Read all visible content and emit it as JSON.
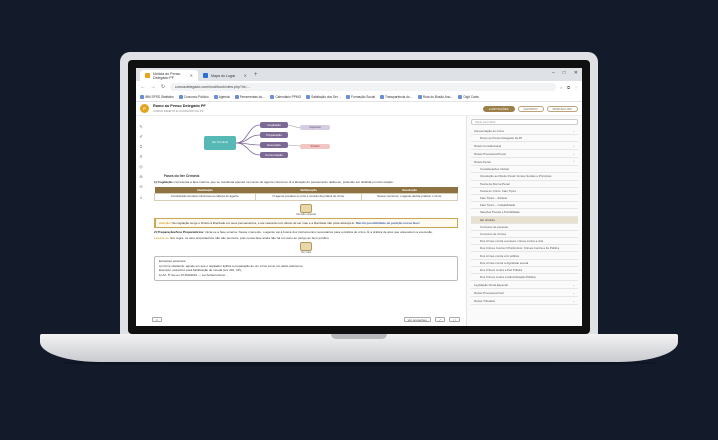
{
  "browser": {
    "tabs": [
      {
        "label": "Notícia ao Penso Delegado PF"
      },
      {
        "label": "Mapa do Lugar"
      }
    ],
    "newtab": "+",
    "window_controls": [
      "–",
      "□",
      "✕"
    ],
    "url": "cursosdelegado.com/mod/book/view.php?id=...",
    "bookmarks": [
      "IBM SPSS Statistics",
      "Concurso Público",
      "Agenda",
      "Ferramentas do…",
      "Calendário PPMG",
      "Satisfação dos Ser…",
      "Formação Social",
      "Transparência do…",
      "Rota do Busão Ano…",
      "Digit Carta"
    ]
  },
  "app": {
    "title": "Rumo ao Penso Delegado PF",
    "subtitle": "CURSO DIREITO E CONTEÚDO DA PF",
    "logo_letter": "P",
    "actions": [
      {
        "label": "● ANOTAÇÕES"
      },
      {
        "label": "FAVORITO"
      },
      {
        "label": "MARCAR LIDO"
      }
    ]
  },
  "mindmap": {
    "center": "Iter Criminis",
    "nodes": [
      "Cogitação",
      "Preparação",
      "Execução",
      "Consumação"
    ],
    "leaves": [
      {
        "label": "Impunível",
        "color": "#d6cde3"
      },
      {
        "label": "Punível",
        "color": "#f3c6c6"
      }
    ]
  },
  "doc": {
    "section_title": "Fases do Iter Criminis",
    "p1_lead": "1) Cogitação:",
    "p1_text": " representa a fase interna, que se manifesta apenas na mente do agente criminoso. É a ideação do pensamento delituoso, podendo ser dividida em três etapas:",
    "table": {
      "headers": [
        "Idealização",
        "Deliberação",
        "Resolução"
      ],
      "row": [
        "Constituição da ideia criminosa na cabeça do agente.",
        "O agente pondera os prós e contras da prática do crime.",
        "Nesse momento, o agente decide praticar o crime."
      ]
    },
    "figure_caption": "Atenção especial",
    "callout_hl": "Atenção!",
    "callout_text": " Na cogitação surge o Direito à liberdade em seus pensamentos, e ele nasceria num direito de ser mau e a liberdade não pode alcançá-lo.",
    "callout_link": "Não há possibilidade de punição nessa fase!",
    "p2_lead": "2) Preparação/Atos Preparatórios:",
    "p2_text": " inicia-se a fase externa. Nesse momento, o agente vai à busca dos instrumentos necessários para a prática do crime. É a prática de atos que antecedem a execução.",
    "p3_hl": "Lembre-se:",
    "p3_text": " Em regra, os atos preparatórios não são puníveis, pois nessa fase ainda não há um risco ao perigo ao bem jurídico.",
    "figure2_caption": "Ver mais",
    "note_lines": [
      "Exceções possíveis:",
      "a) Crime obstáculo: aquele em que o legislador tipifica a preparação de um crime como um delito autônomo;",
      "Exemplo: petrechos para falsificação de moeda (art. 291, CP);",
      "b) Art. 5º da Lei 13.260/2016 — Lei Antiterrorismo..."
    ]
  },
  "bottom": {
    "left": "1",
    "audio": "Ver anotações",
    "right": [
      "⤢",
      "▢"
    ]
  },
  "sidebar": {
    "search_placeholder": "Digite para filtrar",
    "items": [
      {
        "label": "Apresentação do Curso",
        "level": 0,
        "chev": "⌄"
      },
      {
        "label": "Rumo ao Penso Delegado da PF",
        "level": 1,
        "chev": ""
      },
      {
        "label": "Direito Constitucional",
        "level": 0,
        "chev": "⌄"
      },
      {
        "label": "Direito Processual Penal",
        "level": 0,
        "chev": "⌄"
      },
      {
        "label": "Direito Penal",
        "level": 0,
        "chev": "⌃"
      },
      {
        "label": "Considerações Iniciais",
        "level": 1,
        "chev": ""
      },
      {
        "label": "Introdução ao Direito Penal: Fontes Sociais e Princípios",
        "level": 1,
        "chev": ""
      },
      {
        "label": "Teoria da Norma Penal",
        "level": 1,
        "chev": ""
      },
      {
        "label": "Teoria do Crime: Fato Típico",
        "level": 1,
        "chev": ""
      },
      {
        "label": "Fato Típico – Ilicitude",
        "level": 1,
        "chev": ""
      },
      {
        "label": "Fato Típico – Culpabilidade",
        "level": 1,
        "chev": ""
      },
      {
        "label": "Sanções Penais e Punibilidade",
        "level": 1,
        "chev": ""
      },
      {
        "label": "Iter criminis",
        "level": 1,
        "chev": "",
        "active": true
      },
      {
        "label": "Concurso de pessoas",
        "level": 1,
        "chev": ""
      },
      {
        "label": "Concurso de Crimes",
        "level": 1,
        "chev": ""
      },
      {
        "label": "Dos crimes contra a pessoa: crimes contra a vida",
        "level": 1,
        "chev": ""
      },
      {
        "label": "Dos Crimes Contra O Patrimônio; Crimes Contra a Fé Pública",
        "level": 1,
        "chev": ""
      },
      {
        "label": "Dos crimes contra a fé pública",
        "level": 1,
        "chev": ""
      },
      {
        "label": "Dos crimes contra a dignidade sexual",
        "level": 1,
        "chev": ""
      },
      {
        "label": "Dos Crimes contra a Paz Pública",
        "level": 1,
        "chev": ""
      },
      {
        "label": "Dos Crimes contra a Administração Pública",
        "level": 1,
        "chev": ""
      },
      {
        "label": "Legislação Penal Especial",
        "level": 0,
        "chev": "⌄"
      },
      {
        "label": "Direito Processual Civil",
        "level": 0,
        "chev": "⌄"
      },
      {
        "label": "Direito Tributário",
        "level": 0,
        "chev": "⌄"
      }
    ]
  },
  "tools": [
    "✎",
    "✐",
    "⌗",
    "⚲",
    "◎",
    "⊕",
    "⊖",
    "⤓"
  ]
}
